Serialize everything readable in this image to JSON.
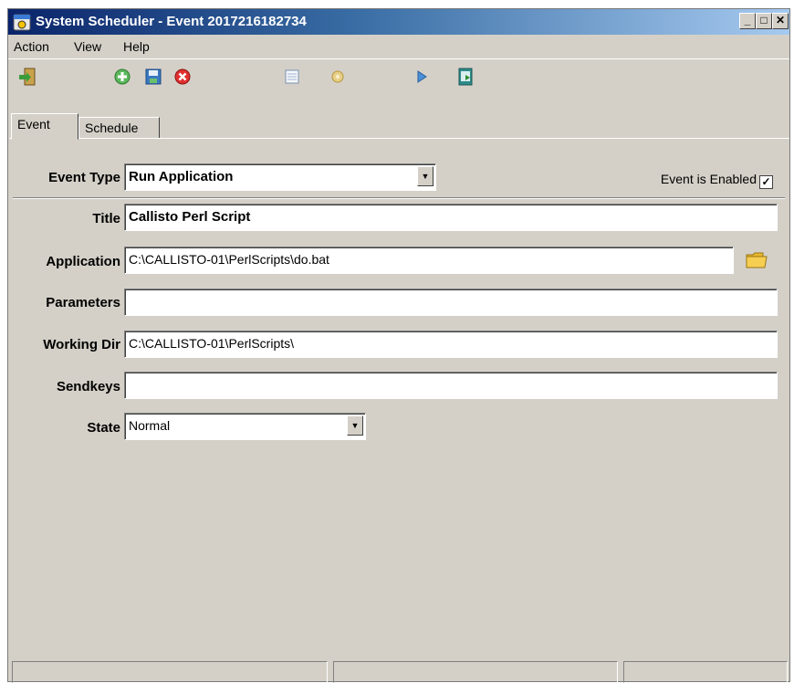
{
  "window": {
    "title": "System Scheduler - Event 2017216182734"
  },
  "menu": [
    "Action",
    "View",
    "Help"
  ],
  "toolbar": [
    "exit-icon",
    "add-icon",
    "save-icon",
    "delete-icon",
    "list-icon",
    "settings-icon",
    "run-icon",
    "export-icon"
  ],
  "tabs": [
    "Event",
    "Schedule"
  ],
  "form": {
    "event_type_label": "Event Type",
    "event_type_value": "Run Application",
    "enabled_label": "Event is Enabled",
    "enabled_checked": true,
    "title_label": "Title",
    "title_value": "Callisto Perl Script",
    "application_label": "Application",
    "application_value": "C:\\CALLISTO-01\\PerlScripts\\do.bat",
    "parameters_label": "Parameters",
    "parameters_value": "",
    "working_dir_label": "Working Dir",
    "working_dir_value": "C:\\CALLISTO-01\\PerlScripts\\",
    "sendkeys_label": "Sendkeys",
    "sendkeys_value": "",
    "state_label": "State",
    "state_value": "Normal"
  },
  "check_mark": "✓",
  "window_buttons": {
    "minimize": "_",
    "maximize": "□",
    "close": "✕"
  }
}
